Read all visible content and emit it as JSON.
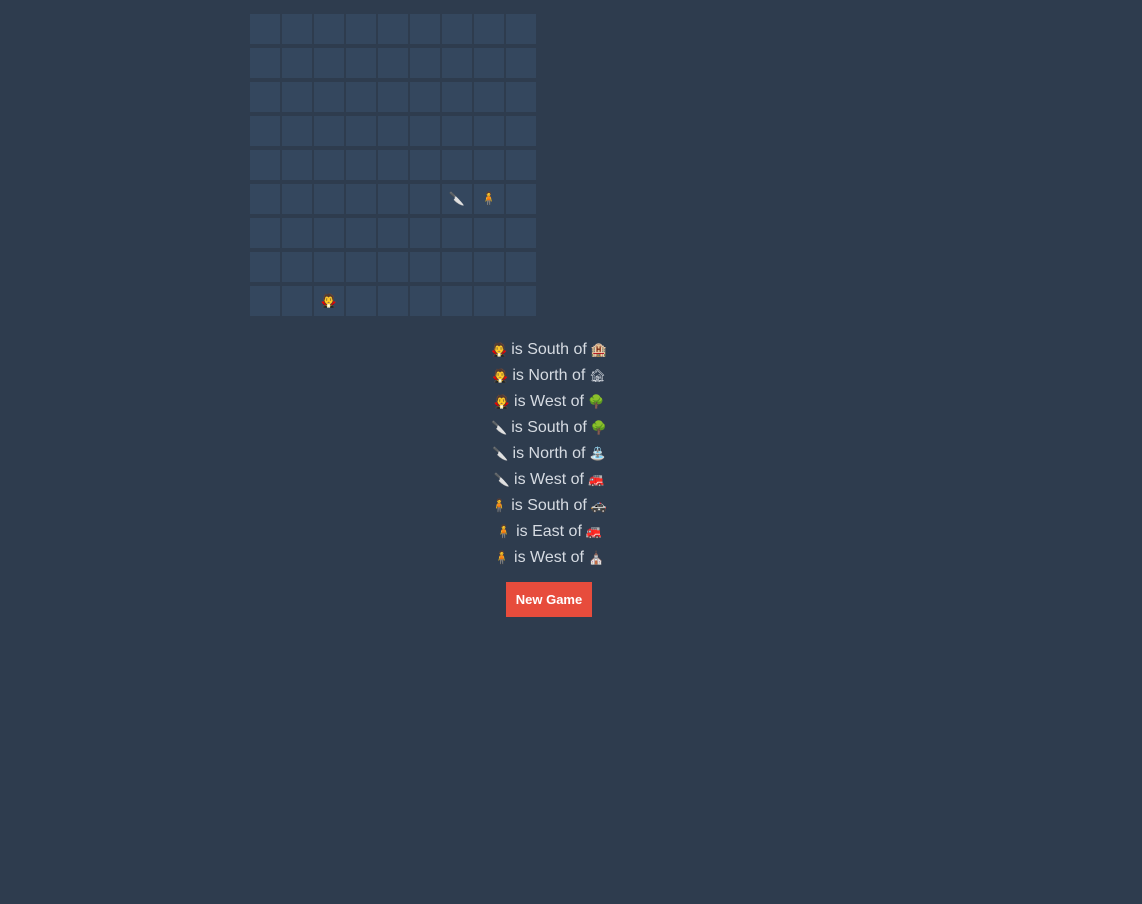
{
  "board": {
    "rows": 9,
    "cols": 9,
    "pieces": [
      {
        "row": 5,
        "col": 6,
        "emoji": "🔪",
        "icon": "knife-icon"
      },
      {
        "row": 5,
        "col": 7,
        "emoji": "🧍",
        "icon": "person-icon"
      },
      {
        "row": 8,
        "col": 2,
        "emoji": "🧛",
        "icon": "vampire-icon"
      }
    ]
  },
  "clues": [
    {
      "subject": "🧛",
      "subject_icon": "vampire-icon",
      "text": "is South of",
      "object": "🏨",
      "object_icon": "hotel-icon"
    },
    {
      "subject": "🧛",
      "subject_icon": "vampire-icon",
      "text": "is North of",
      "object": "🏚",
      "object_icon": "house-icon"
    },
    {
      "subject": "🧛",
      "subject_icon": "vampire-icon",
      "text": "is West of",
      "object": "🌳",
      "object_icon": "tree-icon"
    },
    {
      "subject": "🔪",
      "subject_icon": "knife-icon",
      "text": "is South of",
      "object": "🌳",
      "object_icon": "tree-icon"
    },
    {
      "subject": "🔪",
      "subject_icon": "knife-icon",
      "text": "is North of",
      "object": "⛲",
      "object_icon": "fountain-icon"
    },
    {
      "subject": "🔪",
      "subject_icon": "knife-icon",
      "text": "is West of",
      "object": "🚒",
      "object_icon": "fire-engine-icon"
    },
    {
      "subject": "🧍",
      "subject_icon": "person-icon",
      "text": "is South of",
      "object": "🚓",
      "object_icon": "police-car-icon"
    },
    {
      "subject": "🧍",
      "subject_icon": "person-icon",
      "text": "is East of",
      "object": "🚒",
      "object_icon": "fire-engine-icon"
    },
    {
      "subject": "🧍",
      "subject_icon": "person-icon",
      "text": "is West of",
      "object": "⛪",
      "object_icon": "church-icon"
    }
  ],
  "new_game_label": "New Game"
}
